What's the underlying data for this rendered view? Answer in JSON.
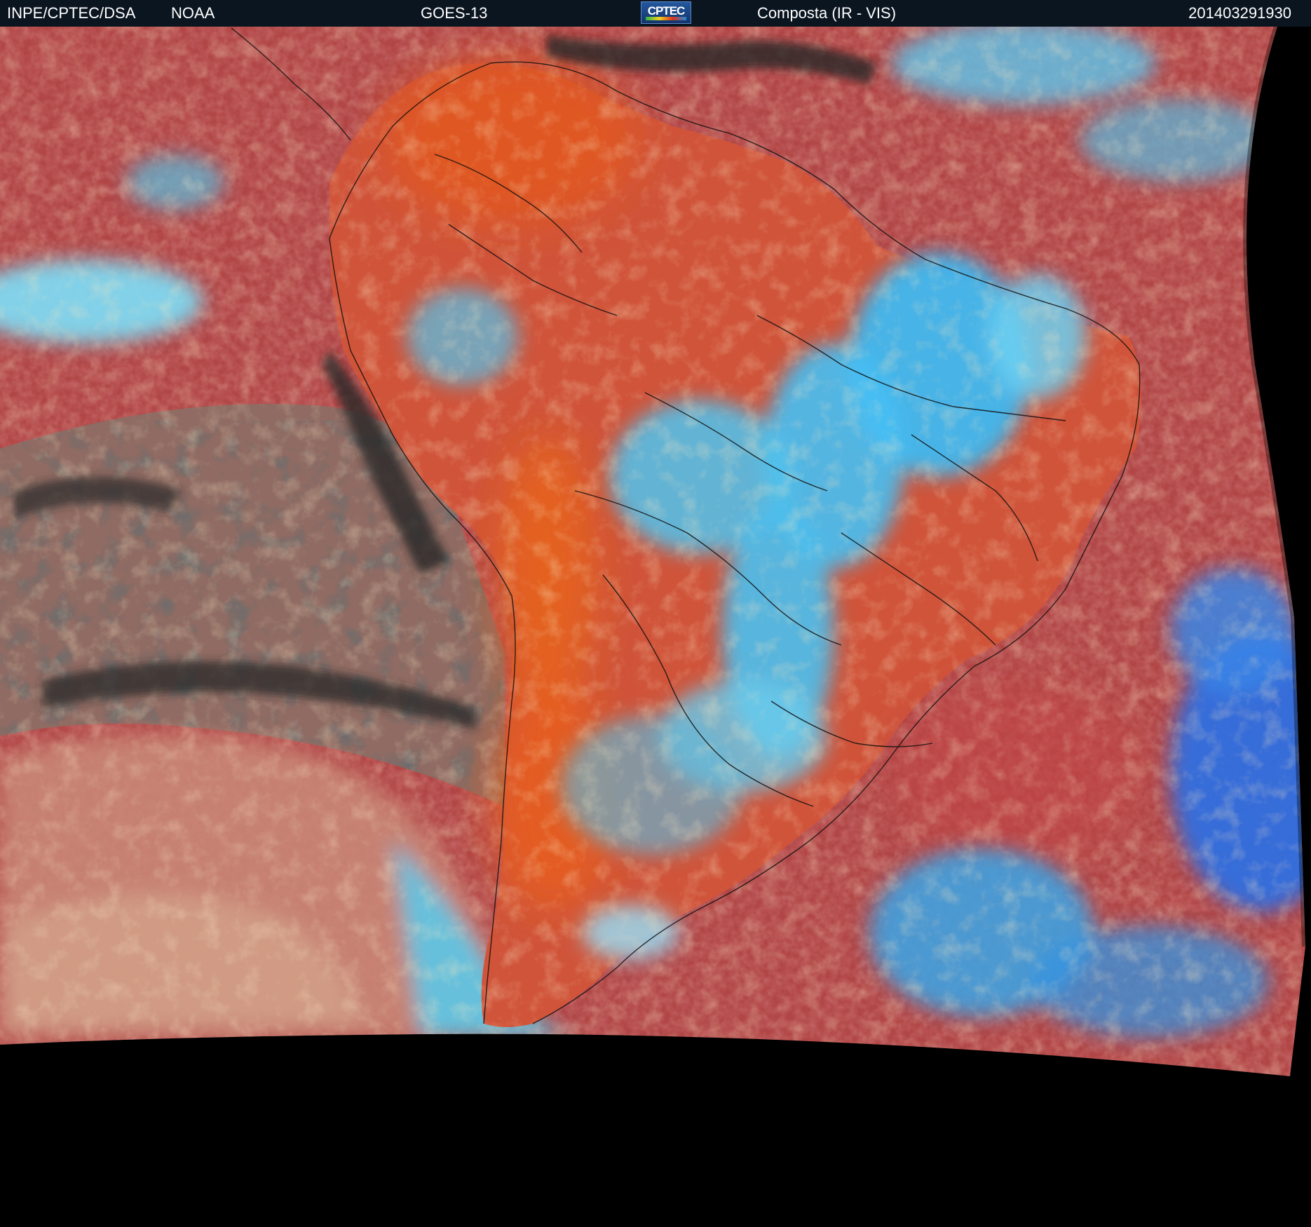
{
  "header": {
    "agency": "INPE/CPTEC/DSA",
    "source": "NOAA",
    "satellite": "GOES-13",
    "logo_text": "CPTEC",
    "product": "Composta (IR - VIS)",
    "timestamp": "201403291930"
  },
  "colors": {
    "header_background": "#0b1520",
    "ocean_base": "#b14646",
    "land_warm": "#d8552f",
    "cloud_cyan": "#3fb8f0",
    "cloud_blue": "#2f6fe0",
    "clear_dark": "#2b2b2b",
    "coastline": "#111111",
    "no_data": "#000000"
  }
}
